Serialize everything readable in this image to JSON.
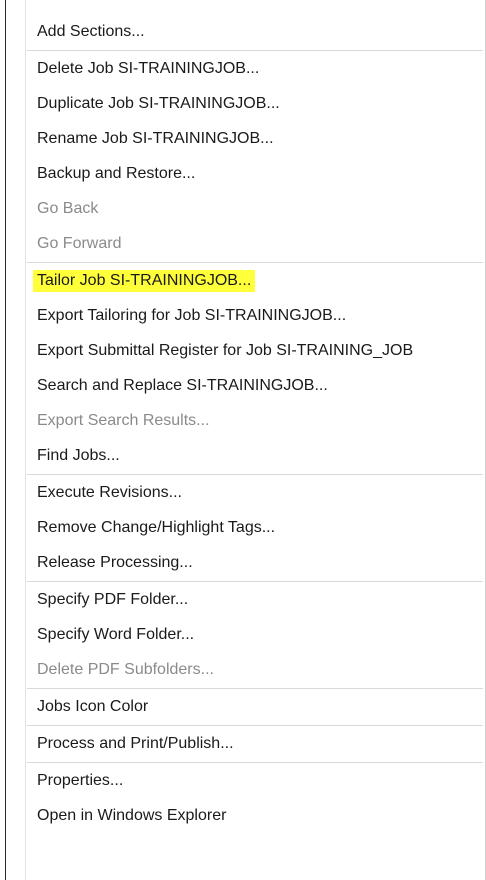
{
  "menu": {
    "groups": [
      {
        "items": [
          {
            "label": "Add Sections..."
          }
        ]
      },
      {
        "items": [
          {
            "label": "Delete Job SI-TRAININGJOB..."
          },
          {
            "label": "Duplicate Job SI-TRAININGJOB..."
          },
          {
            "label": "Rename Job SI-TRAININGJOB..."
          },
          {
            "label": "Backup and Restore..."
          },
          {
            "label": "Go Back",
            "disabled": true
          },
          {
            "label": "Go Forward",
            "disabled": true
          }
        ]
      },
      {
        "items": [
          {
            "label": "Tailor Job SI-TRAININGJOB...",
            "highlighted": true
          },
          {
            "label": "Export Tailoring for Job SI-TRAININGJOB..."
          },
          {
            "label": "Export Submittal Register for Job SI-TRAINING_JOB"
          },
          {
            "label": "Search and Replace SI-TRAININGJOB..."
          },
          {
            "label": "Export Search Results...",
            "disabled": true
          },
          {
            "label": "Find Jobs..."
          }
        ]
      },
      {
        "items": [
          {
            "label": "Execute Revisions..."
          },
          {
            "label": "Remove Change/Highlight Tags..."
          },
          {
            "label": "Release Processing..."
          }
        ]
      },
      {
        "items": [
          {
            "label": "Specify PDF Folder..."
          },
          {
            "label": "Specify Word Folder..."
          },
          {
            "label": "Delete PDF Subfolders...",
            "disabled": true
          }
        ]
      },
      {
        "items": [
          {
            "label": "Jobs Icon Color"
          }
        ]
      },
      {
        "items": [
          {
            "label": "Process and Print/Publish..."
          }
        ]
      },
      {
        "items": [
          {
            "label": "Properties..."
          },
          {
            "label": "Open in Windows Explorer"
          }
        ]
      }
    ],
    "colors": {
      "highlight": "#ffff3a",
      "text": "#1a1a1a",
      "disabled_text": "#8a8a8a",
      "separator": "#d9d9d9"
    }
  }
}
